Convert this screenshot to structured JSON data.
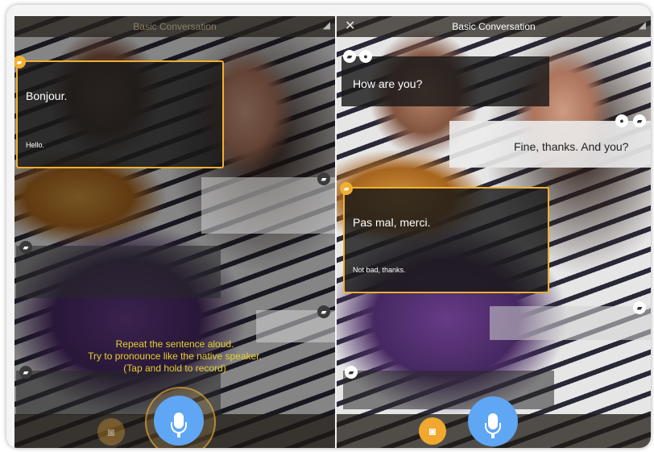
{
  "left": {
    "title": "Basic Conversation",
    "bubble_main": "Bonjour.",
    "bubble_translation": "Hello.",
    "instructions": [
      "Repeat the sentence aloud.",
      "Try to pronounce like the native speaker.",
      "(Tap and hold to record)"
    ]
  },
  "right": {
    "title": "Basic Conversation",
    "close_glyph": "✕",
    "bubble1_main": "How are you?",
    "bubble2_main": "Fine, thanks. And you?",
    "bubble3_main": "Pas mal, merci.",
    "bubble3_translation": "Not bad, thanks."
  },
  "colors": {
    "accent": "#f0b030",
    "mic": "#5fa6f5",
    "instruction_text": "#e6d12e"
  },
  "icons": {
    "speaker": "speech-bubble-icon",
    "person": "person-icon",
    "mic": "microphone-icon",
    "record_small": "headset-icon"
  }
}
